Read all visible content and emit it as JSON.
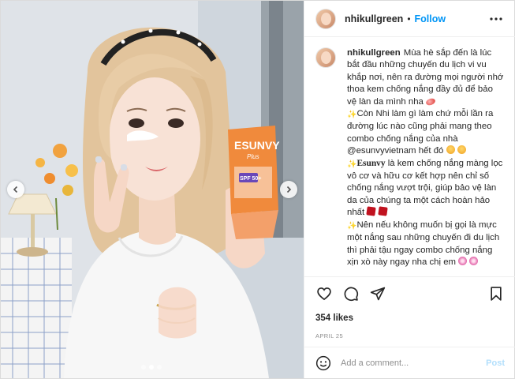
{
  "post": {
    "username": "nhikullgreen",
    "separator": "•",
    "follow_label": "Follow",
    "caption": {
      "username": "nhikullgreen",
      "p1": "Mùa hè sắp đến là lúc bắt đầu những chuyến du lịch vi vu khắp nơi, nên ra đường mọi người nhớ thoa kem chống nắng đầy đủ để bảo vệ làn da mình nha",
      "p2": "Còn Nhi làm gì làm chứ mỗi lần ra đường lúc nào cũng phải mang theo combo chống nắng của nhà @esunvyvietnam hết đó",
      "p3_brand": "Esunvy",
      "p3": " là kem chống nắng màng lọc vô cơ và hữu cơ kết hợp nên chỉ số chống nắng vượt trội, giúp bảo vệ làn da của chúng ta một cách hoàn hảo nhất",
      "p4": "Nên nếu không muốn bị gọi là mực một nắng sau những chuyến đi du lịch thì phải tậu ngay combo chống nắng xịn xò này ngay nha chị em"
    },
    "likes": "354 likes",
    "date": "April 25",
    "comment_placeholder": "Add a comment...",
    "post_label": "Post"
  },
  "media": {
    "product_brand": "ESUNVY",
    "product_sub": "Plus",
    "product_spf": "SPF 50+",
    "carousel_slides": 3,
    "active_slide": 2
  },
  "icons": [
    "more-icon",
    "heart-icon",
    "comment-icon",
    "share-icon",
    "save-icon",
    "emoji-icon",
    "chevron-left-icon",
    "chevron-right-icon"
  ],
  "colors": {
    "follow": "#0095f6",
    "post_disabled": "#b2dffc",
    "tube": "#f08a3c",
    "text": "#262626",
    "muted": "#8e8e8e"
  }
}
